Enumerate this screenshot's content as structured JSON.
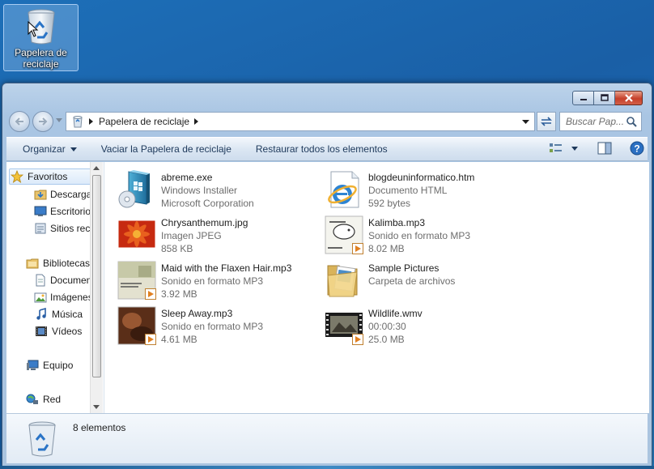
{
  "desktop": {
    "recycle_icon_label": "Papelera de reciclaje"
  },
  "window": {
    "breadcrumb": "Papelera de reciclaje",
    "search_placeholder": "Buscar Pap...",
    "commands": {
      "organize": "Organizar",
      "empty": "Vaciar la Papelera de reciclaje",
      "restore_all": "Restaurar todos los elementos"
    },
    "nav": [
      {
        "label": "Favoritos",
        "icon": "star-icon"
      },
      {
        "label": "Descargas",
        "icon": "downloads-folder-icon"
      },
      {
        "label": "Escritorio",
        "icon": "desktop-icon"
      },
      {
        "label": "Sitios recientes",
        "icon": "recent-places-icon"
      },
      {
        "label": "Bibliotecas",
        "icon": "libraries-icon"
      },
      {
        "label": "Documentos",
        "icon": "documents-icon"
      },
      {
        "label": "Imágenes",
        "icon": "pictures-icon"
      },
      {
        "label": "Música",
        "icon": "music-icon"
      },
      {
        "label": "Vídeos",
        "icon": "videos-icon"
      },
      {
        "label": "Equipo",
        "icon": "computer-icon"
      },
      {
        "label": "Red",
        "icon": "network-icon"
      }
    ],
    "files": [
      {
        "name": "abreme.exe",
        "line2": "Windows Installer",
        "line3": "Microsoft Corporation",
        "icon": "installer-icon"
      },
      {
        "name": "blogdeuninformatico.htm",
        "line2": "Documento HTML",
        "line3": "592 bytes",
        "icon": "ie-document-icon"
      },
      {
        "name": "Chrysanthemum.jpg",
        "line2": "Imagen JPEG",
        "line3": "858 KB",
        "icon": "image-thumbnail"
      },
      {
        "name": "Kalimba.mp3",
        "line2": "Sonido en formato MP3",
        "line3": "8.02 MB",
        "icon": "album-art-thumbnail"
      },
      {
        "name": "Maid with the Flaxen Hair.mp3",
        "line2": "Sonido en formato MP3",
        "line3": "3.92 MB",
        "icon": "album-art-thumbnail"
      },
      {
        "name": "Sample Pictures",
        "line2": "Carpeta de archivos",
        "line3": "",
        "icon": "folder-icon"
      },
      {
        "name": "Sleep Away.mp3",
        "line2": "Sonido en formato MP3",
        "line3": "4.61 MB",
        "icon": "album-art-thumbnail"
      },
      {
        "name": "Wildlife.wmv",
        "line2": "00:00:30",
        "line3": "25.0 MB",
        "icon": "video-thumbnail"
      }
    ],
    "status_count": "8 elementos"
  }
}
